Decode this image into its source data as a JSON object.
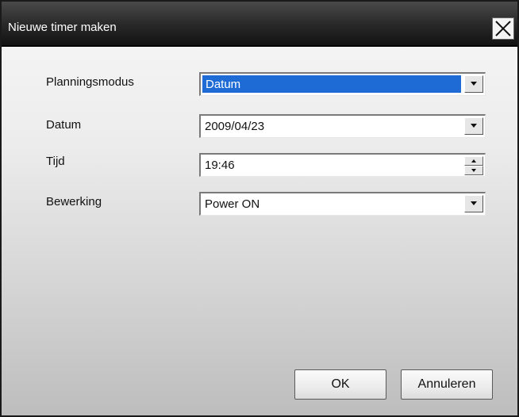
{
  "window": {
    "title": "Nieuwe timer maken"
  },
  "form": {
    "planning_mode": {
      "label": "Planningsmodus",
      "value": "Datum"
    },
    "date": {
      "label": "Datum",
      "value": "2009/04/23"
    },
    "time": {
      "label": "Tijd",
      "value": "19:46"
    },
    "operation": {
      "label": "Bewerking",
      "value": "Power ON"
    }
  },
  "buttons": {
    "ok_label": "OK",
    "cancel_label": "Annuleren"
  },
  "colors": {
    "selection": "#1e6bd6",
    "titlebar": "#2a2a2a"
  }
}
